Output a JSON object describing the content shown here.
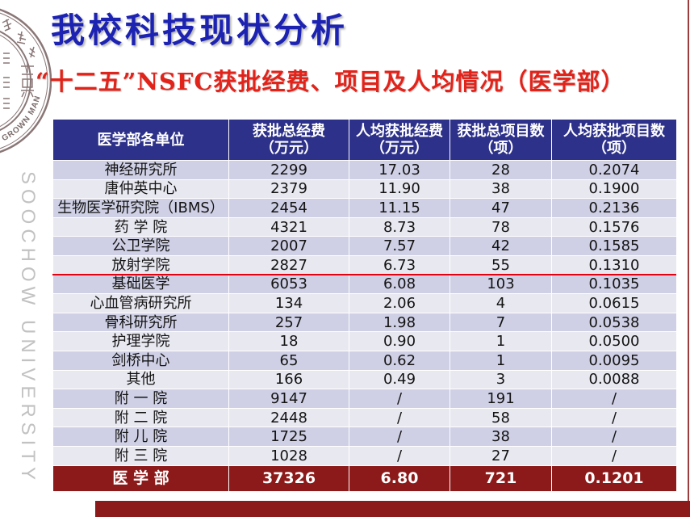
{
  "slide": {
    "title": "我校科技现状分析",
    "subtitle": "“十二五”NSFC获批经费、项目及人均情况（医学部）",
    "watermark": "SOOCHOW UNIVERSITY",
    "logo_motto": "GROWN MAN"
  },
  "table": {
    "columns": [
      {
        "label": "医学部各单位"
      },
      {
        "label": "获批总经费",
        "unit": "（万元）"
      },
      {
        "label": "人均获批经费",
        "unit": "（万元）"
      },
      {
        "label": "获批总项目数",
        "unit": "（项）"
      },
      {
        "label": "人均获批项目数",
        "unit": "（项）"
      }
    ],
    "rows": [
      {
        "unit": "神经研究所",
        "total_funding": "2299",
        "funding_per_capita": "17.03",
        "total_projects": "28",
        "projects_per_capita": "0.2074"
      },
      {
        "unit": "唐仲英中心",
        "total_funding": "2379",
        "funding_per_capita": "11.90",
        "total_projects": "38",
        "projects_per_capita": "0.1900"
      },
      {
        "unit": "生物医学研究院（IBMS）",
        "total_funding": "2454",
        "funding_per_capita": "11.15",
        "total_projects": "47",
        "projects_per_capita": "0.2136"
      },
      {
        "unit": "药 学 院",
        "total_funding": "4321",
        "funding_per_capita": "8.73",
        "total_projects": "78",
        "projects_per_capita": "0.1576"
      },
      {
        "unit": "公卫学院",
        "total_funding": "2007",
        "funding_per_capita": "7.57",
        "total_projects": "42",
        "projects_per_capita": "0.1585"
      },
      {
        "unit": "放射学院",
        "total_funding": "2827",
        "funding_per_capita": "6.73",
        "total_projects": "55",
        "projects_per_capita": "0.1310"
      },
      {
        "unit": "基础医学",
        "total_funding": "6053",
        "funding_per_capita": "6.08",
        "total_projects": "103",
        "projects_per_capita": "0.1035"
      },
      {
        "unit": "心血管病研究所",
        "total_funding": "134",
        "funding_per_capita": "2.06",
        "total_projects": "4",
        "projects_per_capita": "0.0615"
      },
      {
        "unit": "骨科研究所",
        "total_funding": "257",
        "funding_per_capita": "1.98",
        "total_projects": "7",
        "projects_per_capita": "0.0538"
      },
      {
        "unit": "护理学院",
        "total_funding": "18",
        "funding_per_capita": "0.90",
        "total_projects": "1",
        "projects_per_capita": "0.0500"
      },
      {
        "unit": "剑桥中心",
        "total_funding": "65",
        "funding_per_capita": "0.62",
        "total_projects": "1",
        "projects_per_capita": "0.0095"
      },
      {
        "unit": "其他",
        "total_funding": "166",
        "funding_per_capita": "0.49",
        "total_projects": "3",
        "projects_per_capita": "0.0088"
      },
      {
        "unit": "附 一 院",
        "total_funding": "9147",
        "funding_per_capita": "/",
        "total_projects": "191",
        "projects_per_capita": "/"
      },
      {
        "unit": "附 二 院",
        "total_funding": "2448",
        "funding_per_capita": "/",
        "total_projects": "58",
        "projects_per_capita": "/"
      },
      {
        "unit": "附 儿 院",
        "total_funding": "1725",
        "funding_per_capita": "/",
        "total_projects": "38",
        "projects_per_capita": "/"
      },
      {
        "unit": "附 三 院",
        "total_funding": "1028",
        "funding_per_capita": "/",
        "total_projects": "27",
        "projects_per_capita": "/"
      }
    ],
    "total": {
      "unit": "医 学 部",
      "total_funding": "37326",
      "funding_per_capita": "6.80",
      "total_projects": "721",
      "projects_per_capita": "0.1201"
    }
  },
  "colors": {
    "title": "#1c22b2",
    "subtitle": "#e2231a",
    "header_bg": "#2d318a",
    "band_dark": "#cfd0e5",
    "band_light": "#e8e8f1",
    "total_bg": "#8c1a1a",
    "divider": "#e3000f",
    "accent_bar": "#8c1a1a",
    "watermark": "#c2c2c2"
  }
}
